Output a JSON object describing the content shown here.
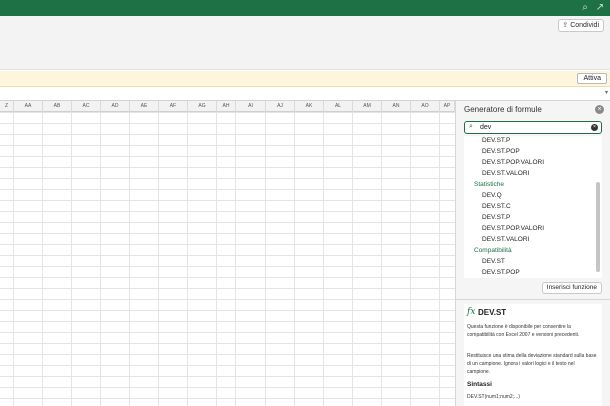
{
  "titlebar": {
    "search_icon": "search-icon",
    "share_icon": "share-icon"
  },
  "ribbon": {
    "share_label": "Condividi"
  },
  "notice": {
    "button_label": "Attiva"
  },
  "grid": {
    "columns": [
      "Z",
      "AA",
      "AB",
      "AC",
      "AD",
      "AE",
      "AF",
      "AG",
      "AH",
      "AI",
      "AJ",
      "AK",
      "AL",
      "AM",
      "AN",
      "AO",
      "AP"
    ]
  },
  "pane": {
    "title": "Generatore di formule",
    "search_value": "dev",
    "list": [
      {
        "kind": "item",
        "label": "DEV.ST.P"
      },
      {
        "kind": "item",
        "label": "DEV.ST.POP"
      },
      {
        "kind": "item",
        "label": "DEV.ST.POP.VALORI"
      },
      {
        "kind": "item",
        "label": "DEV.ST.VALORI"
      },
      {
        "kind": "header",
        "label": "Statistiche"
      },
      {
        "kind": "item",
        "label": "DEV.Q"
      },
      {
        "kind": "item",
        "label": "DEV.ST.C"
      },
      {
        "kind": "item",
        "label": "DEV.ST.P"
      },
      {
        "kind": "item",
        "label": "DEV.ST.POP.VALORI"
      },
      {
        "kind": "item",
        "label": "DEV.ST.VALORI"
      },
      {
        "kind": "header",
        "label": "Compatibilità"
      },
      {
        "kind": "item",
        "label": "DEV.ST"
      },
      {
        "kind": "item",
        "label": "DEV.ST.POP"
      }
    ],
    "insert_label": "Inserisci funzione",
    "help": {
      "fx": "fx",
      "name": "DEV.ST",
      "para1": "Questa funzione è disponibile per consentire la compatibilità con Excel 2007 e versioni precedenti.",
      "para2": "Restituisce una stima della deviazione standard sulla base di un campione. Ignora i valori logici e il testo nel campione.",
      "syntax_heading": "Sintassi",
      "syntax": "DEV.ST(num1;num2;...)"
    }
  },
  "colors": {
    "accent": "#1e7145",
    "notice_bg": "#fdf6dd"
  }
}
